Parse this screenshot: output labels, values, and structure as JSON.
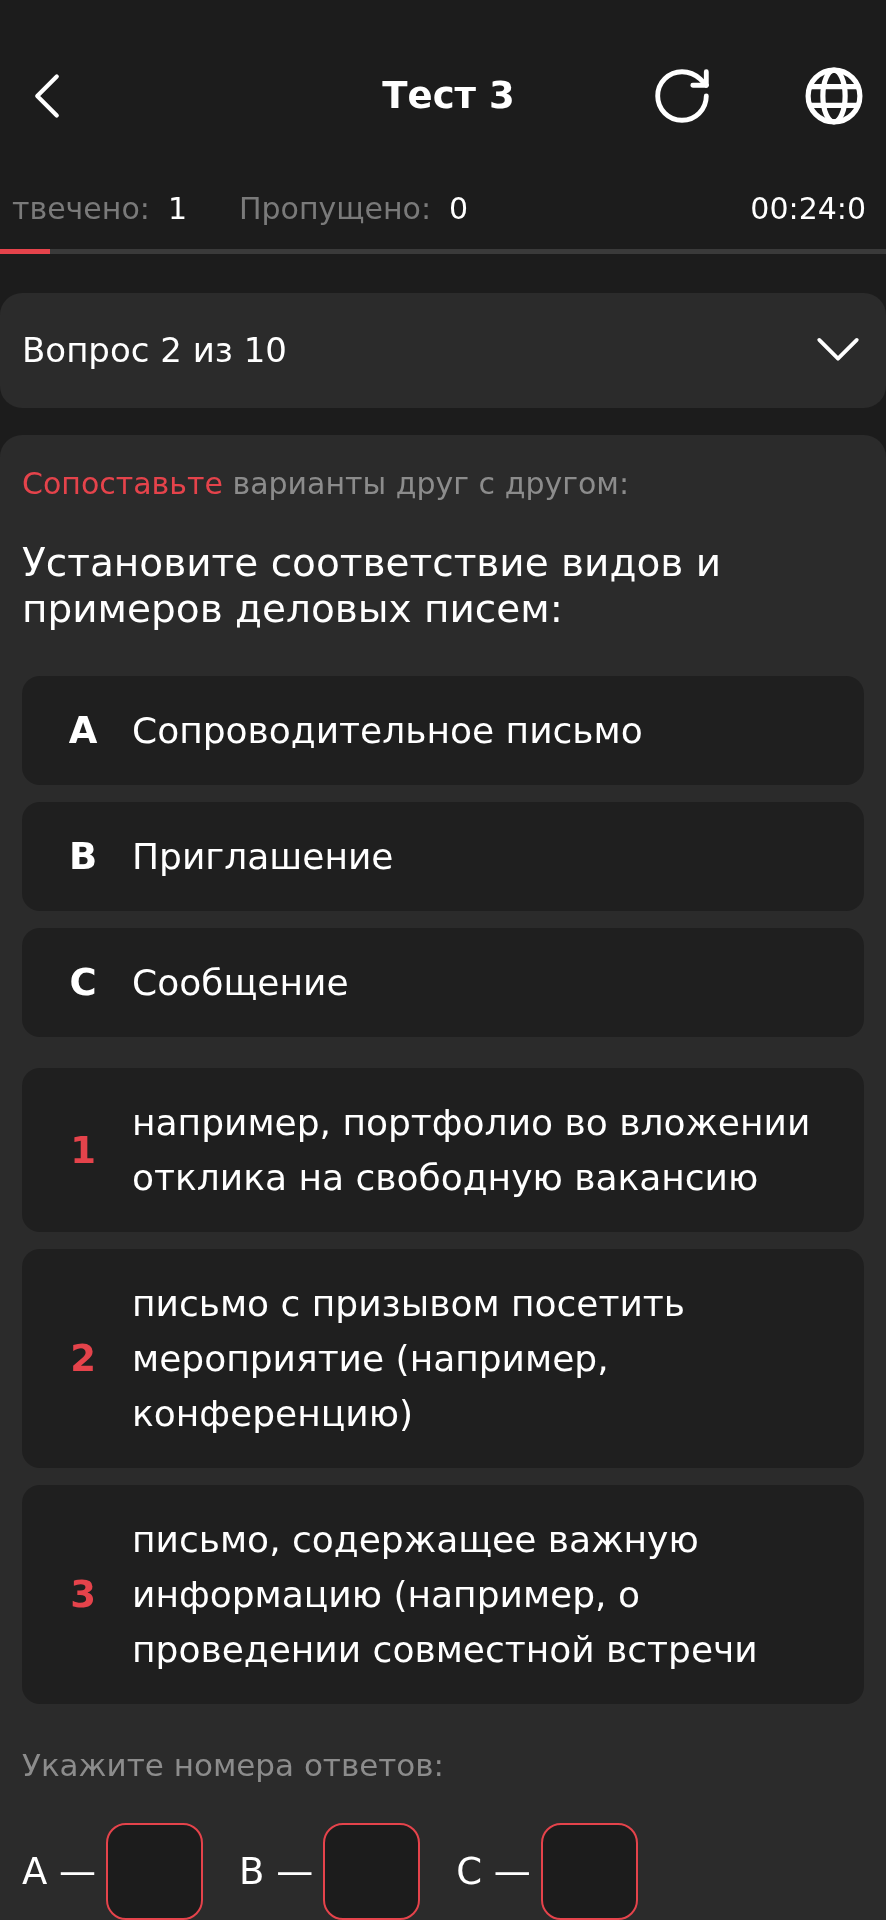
{
  "header": {
    "title": "Тест 3"
  },
  "stats": [
    {
      "label": "твечено:",
      "value": "1"
    },
    {
      "label": "Пропущено:",
      "value": "0"
    }
  ],
  "timer": "00:24:0",
  "progress": {
    "level": 0.056
  },
  "question_selector": {
    "label": "Вопрос 2 из 10",
    "expanded": false
  },
  "question": {
    "instruction": {
      "highlight": "Сопоставьте",
      "text": "варианты друг с другом:"
    },
    "text": "Установите соответствие видов и примеров деловых писем:"
  },
  "options": [
    {
      "marker": "A",
      "text": "Сопроводительное письмо"
    },
    {
      "marker": "B",
      "text": "Приглашение"
    },
    {
      "marker": "C",
      "text": "Сообщение"
    }
  ],
  "matches": [
    {
      "marker": "1",
      "text": "например, портфолио во вложении отклика на свободную вакансию"
    },
    {
      "marker": "2",
      "text": "письмо с призывом посетить мероприятие (например, конференцию)"
    },
    {
      "marker": "3",
      "text": "письмо, содержащее важную информацию (например, о проведении совместной встречи"
    }
  ],
  "answer_prompt": "Укажите номера ответов:",
  "answer_fields": [
    {
      "label": "A —"
    },
    {
      "label": "B —"
    },
    {
      "label": "C —"
    }
  ]
}
